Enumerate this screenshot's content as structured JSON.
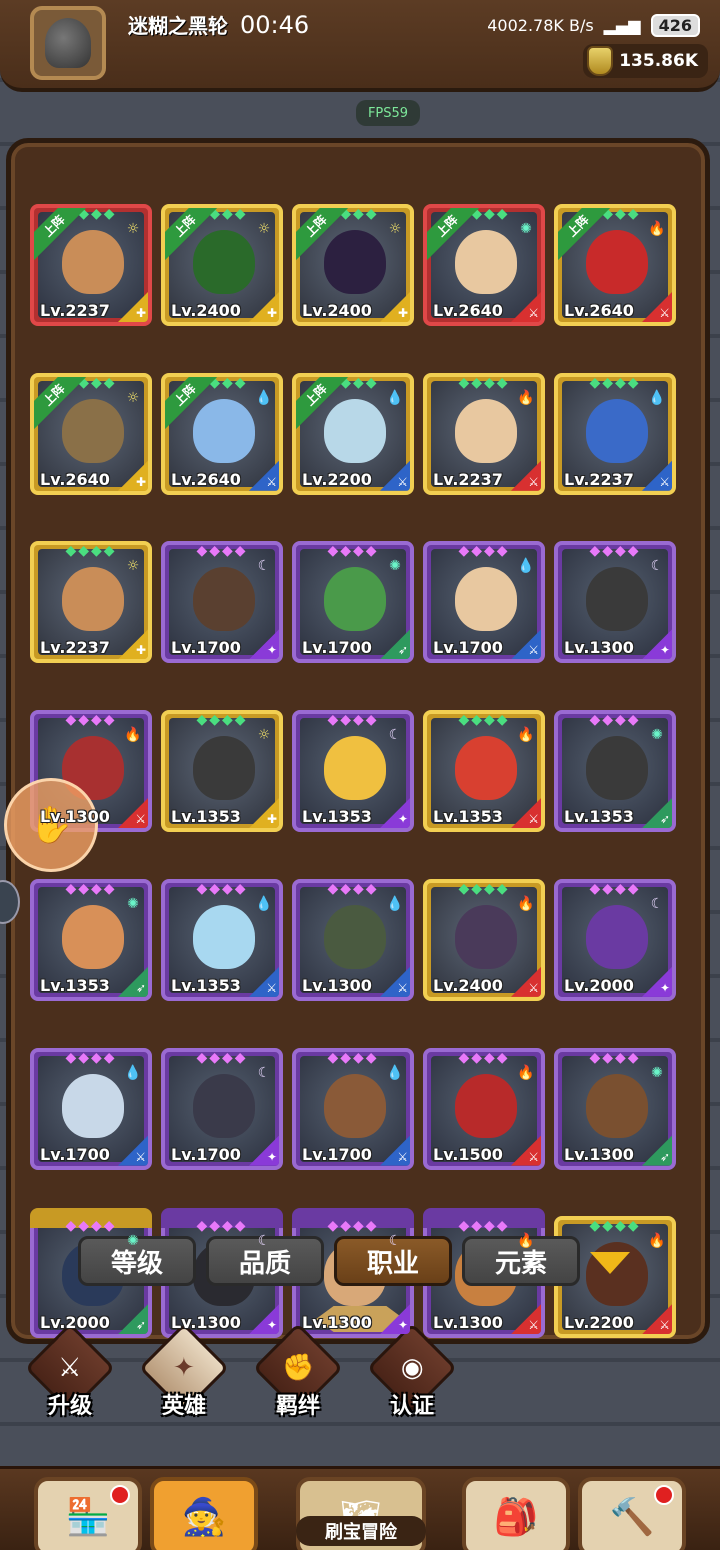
{
  "header": {
    "player_name": "迷糊之黑轮",
    "gold": "135.86K",
    "fps": "FPS59"
  },
  "statusbar": {
    "time": "00:46",
    "net_speed": "4002.78K B/s",
    "battery": "426"
  },
  "heroes": [
    {
      "level": "Lv.2237",
      "rarity": "red",
      "element": "sun",
      "role": "gold",
      "up": true,
      "face": "#c98d58"
    },
    {
      "level": "Lv.2400",
      "rarity": "gold",
      "element": "sun",
      "role": "gold",
      "up": true,
      "face": "#2a6a2a"
    },
    {
      "level": "Lv.2400",
      "rarity": "gold",
      "element": "sun",
      "role": "gold",
      "up": true,
      "face": "#2c2040"
    },
    {
      "level": "Lv.2640",
      "rarity": "red",
      "element": "wind",
      "role": "red",
      "up": true,
      "face": "#e8c8a0"
    },
    {
      "level": "Lv.2640",
      "rarity": "gold",
      "element": "fire",
      "role": "red",
      "up": true,
      "face": "#c82a2a"
    },
    {
      "level": "Lv.2640",
      "rarity": "gold",
      "element": "sun",
      "role": "gold",
      "up": true,
      "face": "#8a7048"
    },
    {
      "level": "Lv.2640",
      "rarity": "gold",
      "element": "water",
      "role": "blue",
      "up": true,
      "face": "#8ab8e8"
    },
    {
      "level": "Lv.2200",
      "rarity": "gold",
      "element": "water",
      "role": "blue",
      "up": true,
      "face": "#b8d8e8"
    },
    {
      "level": "Lv.2237",
      "rarity": "gold",
      "element": "fire",
      "role": "red",
      "up": false,
      "face": "#e8c8a0"
    },
    {
      "level": "Lv.2237",
      "rarity": "gold",
      "element": "water",
      "role": "blue",
      "up": false,
      "face": "#3a6ac8"
    },
    {
      "level": "Lv.2237",
      "rarity": "gold",
      "element": "sun",
      "role": "gold",
      "up": false,
      "face": "#c98d58"
    },
    {
      "level": "Lv.1700",
      "rarity": "purple",
      "element": "moon",
      "role": "purple",
      "up": false,
      "face": "#5a4030"
    },
    {
      "level": "Lv.1700",
      "rarity": "purple",
      "element": "wind",
      "role": "green",
      "up": false,
      "face": "#4a9a4a"
    },
    {
      "level": "Lv.1700",
      "rarity": "purple",
      "element": "water",
      "role": "blue",
      "up": false,
      "face": "#e8c8a0"
    },
    {
      "level": "Lv.1300",
      "rarity": "purple",
      "element": "moon",
      "role": "purple",
      "up": false,
      "face": "#3a3a3a"
    },
    {
      "level": "Lv.1300",
      "rarity": "purple",
      "element": "fire",
      "role": "red",
      "up": false,
      "face": "#a83030"
    },
    {
      "level": "Lv.1353",
      "rarity": "gold",
      "element": "sun",
      "role": "gold",
      "up": false,
      "face": "#3a3a3a"
    },
    {
      "level": "Lv.1353",
      "rarity": "purple",
      "element": "moon",
      "role": "purple",
      "up": false,
      "face": "#f0c040"
    },
    {
      "level": "Lv.1353",
      "rarity": "gold",
      "element": "fire",
      "role": "red",
      "up": false,
      "face": "#d84030"
    },
    {
      "level": "Lv.1353",
      "rarity": "purple",
      "element": "wind",
      "role": "green",
      "up": false,
      "face": "#3a3a3a"
    },
    {
      "level": "Lv.1353",
      "rarity": "purple",
      "element": "wind",
      "role": "green",
      "up": false,
      "face": "#d89058"
    },
    {
      "level": "Lv.1353",
      "rarity": "purple",
      "element": "water",
      "role": "blue",
      "up": false,
      "face": "#a8d8f0"
    },
    {
      "level": "Lv.1300",
      "rarity": "purple",
      "element": "water",
      "role": "blue",
      "up": false,
      "face": "#4a5a40"
    },
    {
      "level": "Lv.2400",
      "rarity": "gold",
      "element": "fire",
      "role": "red",
      "up": false,
      "face": "#4a3a5a"
    },
    {
      "level": "Lv.2000",
      "rarity": "purple",
      "element": "moon",
      "role": "purple",
      "up": false,
      "face": "#6a3aa2"
    },
    {
      "level": "Lv.1700",
      "rarity": "purple",
      "element": "water",
      "role": "blue",
      "up": false,
      "face": "#c8d8e8"
    },
    {
      "level": "Lv.1700",
      "rarity": "purple",
      "element": "moon",
      "role": "purple",
      "up": false,
      "face": "#3a3a4a"
    },
    {
      "level": "Lv.1700",
      "rarity": "purple",
      "element": "water",
      "role": "blue",
      "up": false,
      "face": "#8a5a38"
    },
    {
      "level": "Lv.1500",
      "rarity": "purple",
      "element": "fire",
      "role": "red",
      "up": false,
      "face": "#b82a2a"
    },
    {
      "level": "Lv.1300",
      "rarity": "purple",
      "element": "wind",
      "role": "green",
      "up": false,
      "face": "#7a5030"
    },
    {
      "level": "Lv.2000",
      "rarity": "purple",
      "element": "wind",
      "role": "green",
      "up": false,
      "face": "#2a3a5a"
    },
    {
      "level": "Lv.1300",
      "rarity": "purple",
      "element": "moon",
      "role": "purple",
      "up": false,
      "face": "#2a2a30"
    },
    {
      "level": "Lv.1300",
      "rarity": "purple",
      "element": "moon",
      "role": "purple",
      "up": false,
      "face": "#d8a878"
    },
    {
      "level": "Lv.1300",
      "rarity": "purple",
      "element": "fire",
      "role": "red",
      "up": false,
      "face": "#c88040"
    },
    {
      "level": "Lv.2200",
      "rarity": "gold",
      "element": "fire",
      "role": "red",
      "up": false,
      "face": "#5a3020"
    }
  ],
  "partial_row_rarities": [
    "gold",
    "purple",
    "purple",
    "purple"
  ],
  "up_label": "上阵",
  "sort_tabs": [
    {
      "label": "等级",
      "active": false
    },
    {
      "label": "品质",
      "active": false
    },
    {
      "label": "职业",
      "active": true
    },
    {
      "label": "元素",
      "active": false
    }
  ],
  "subnav": [
    {
      "label": "升级",
      "icon": "sword-icon",
      "glyph": "⚔",
      "active": false
    },
    {
      "label": "英雄",
      "icon": "hero-icon",
      "glyph": "✦",
      "active": true
    },
    {
      "label": "羁绊",
      "icon": "fist-icon",
      "glyph": "✊",
      "active": false
    },
    {
      "label": "认证",
      "icon": "eye-icon",
      "glyph": "◉",
      "active": false
    }
  ],
  "bottom_nav": {
    "center_label": "刷宝冒险"
  }
}
